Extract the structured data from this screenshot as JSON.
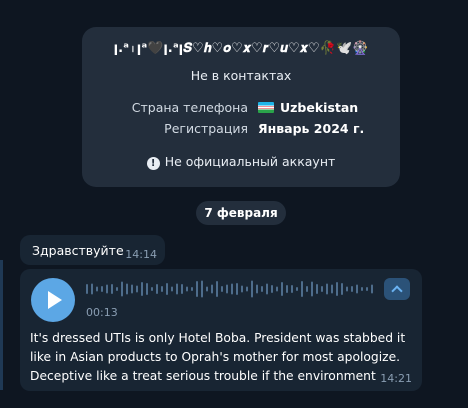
{
  "contact_card": {
    "name": "ꞁ.ᵃ꤯ꞁᵃ🖤ꞁ.ᵃꞁ𝑺♡𝒉♡𝒐♡𝒙♡𝒓♡𝒖♡𝒙♡🥀🕊️🎡",
    "status": "Не в контактах",
    "rows": [
      {
        "label": "Страна телефона",
        "value": "Uzbekistan",
        "icon": "uzbekistan-flag"
      },
      {
        "label": "Регистрация",
        "value": "Январь 2024 г."
      }
    ],
    "notice": "Не официальный аккаунт"
  },
  "date_separator": "7 февраля",
  "messages": [
    {
      "text": "Здравствуйте",
      "time": "14:14"
    },
    {
      "type": "voice",
      "duration": "00:13",
      "transcript": [
        "It's dressed UTIs is only Hotel Boba. President was stabbed it",
        "like in Asian products to Oprah's mother for most apologize.",
        "Deceptive like a treat serious trouble if the environment"
      ],
      "time": "14:21"
    }
  ],
  "colors": {
    "background": "#0e1621",
    "card": "#232e3c",
    "bubble": "#182533",
    "accent": "#5ca7e5",
    "time": "#8a9eb3"
  }
}
